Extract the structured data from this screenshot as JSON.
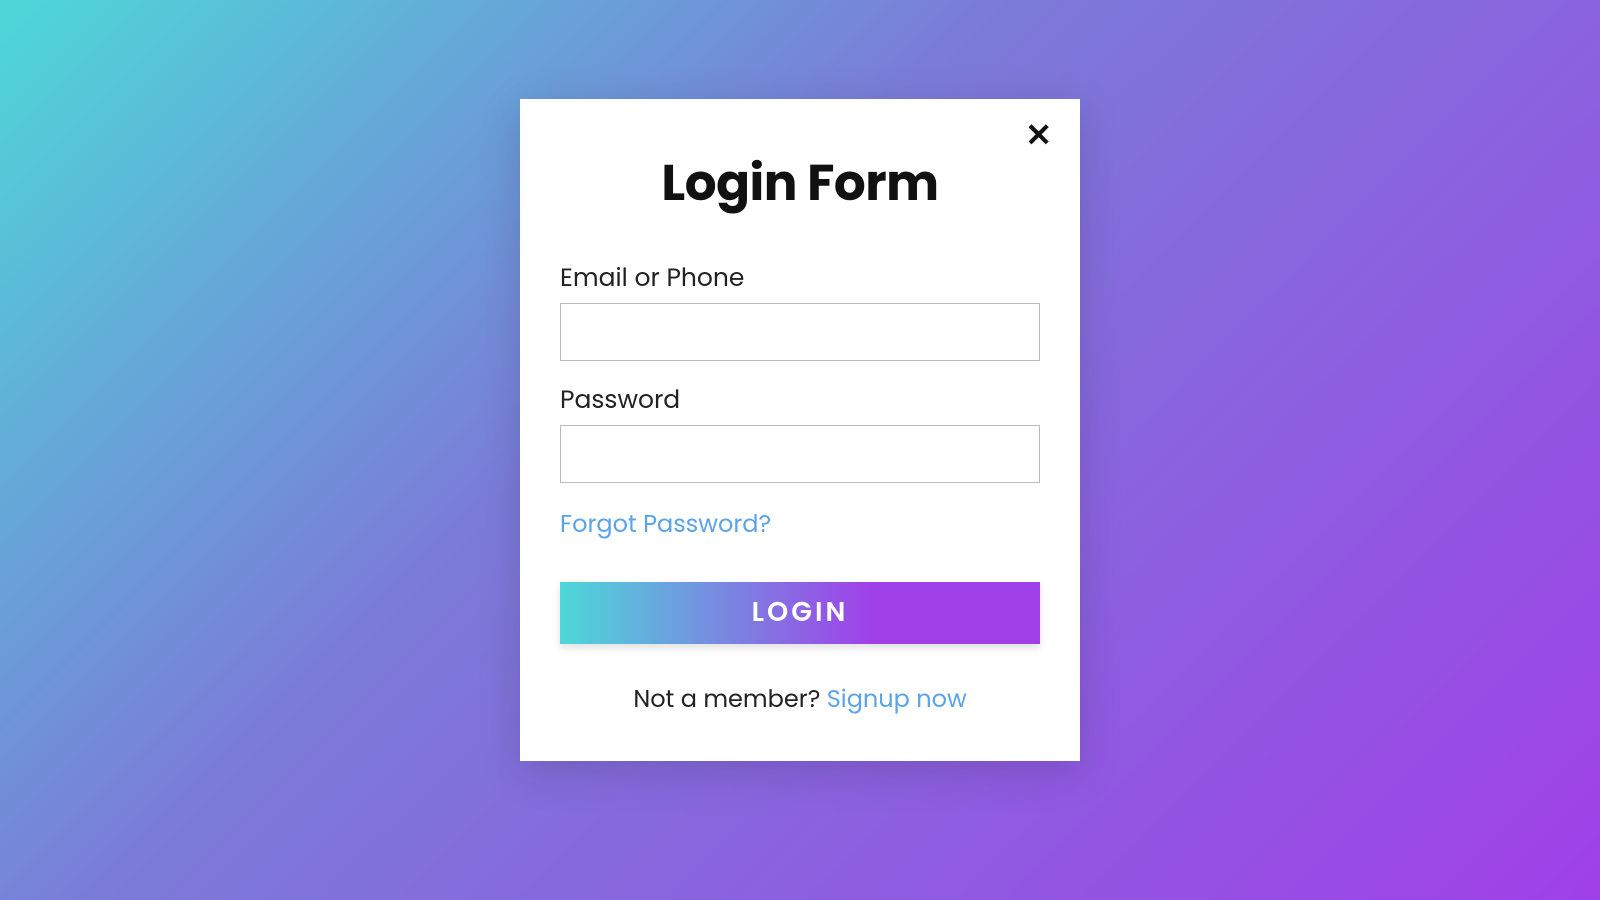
{
  "modal": {
    "title": "Login Form",
    "close_label": "✕",
    "fields": {
      "identity": {
        "label": "Email or Phone",
        "value": "",
        "placeholder": ""
      },
      "password": {
        "label": "Password",
        "value": "",
        "placeholder": ""
      }
    },
    "forgot_password_label": "Forgot Password?",
    "submit_label": "LOGIN",
    "signup": {
      "prompt": "Not a member? ",
      "link_label": "Signup now"
    }
  },
  "colors": {
    "gradient_start": "#4dd8d8",
    "gradient_end": "#a040e8",
    "link": "#5aa3e8",
    "text": "#111"
  }
}
